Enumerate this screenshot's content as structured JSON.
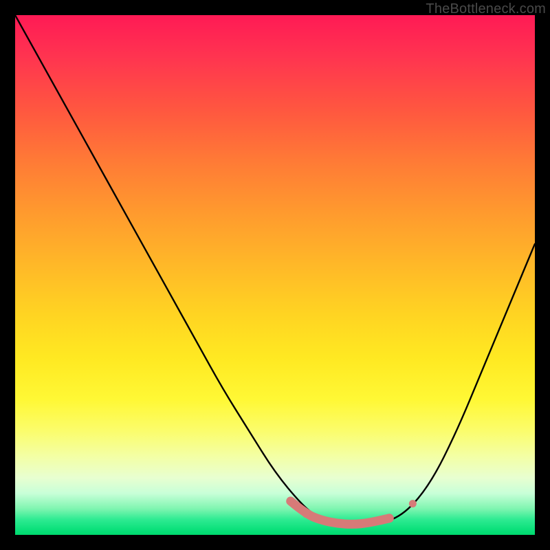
{
  "watermark": "TheBottleneck.com",
  "chart_data": {
    "type": "line",
    "title": "",
    "xlabel": "",
    "ylabel": "",
    "xlim": [
      0,
      100
    ],
    "ylim": [
      0,
      100
    ],
    "grid": false,
    "series": [
      {
        "name": "curve",
        "x": [
          0,
          5,
          10,
          15,
          20,
          25,
          30,
          35,
          40,
          45,
          50,
          55,
          58,
          60,
          63,
          65,
          70,
          75,
          80,
          85,
          90,
          95,
          100
        ],
        "y": [
          100,
          91,
          82,
          73,
          64,
          55,
          46,
          37,
          28,
          20,
          12,
          6,
          3.5,
          2.5,
          2,
          2,
          2,
          4,
          10,
          20,
          32,
          44,
          56
        ]
      }
    ],
    "markers": [
      {
        "name": "left-flat-start",
        "x": 53,
        "y": 6.5
      },
      {
        "name": "flat-1",
        "x": 56,
        "y": 4.0
      },
      {
        "name": "flat-2",
        "x": 59,
        "y": 2.8
      },
      {
        "name": "flat-3",
        "x": 62,
        "y": 2.2
      },
      {
        "name": "flat-4",
        "x": 65,
        "y": 2.0
      },
      {
        "name": "flat-5",
        "x": 68,
        "y": 2.3
      },
      {
        "name": "right-flat-end",
        "x": 72,
        "y": 3.2
      },
      {
        "name": "right-up-dot",
        "x": 76.5,
        "y": 6.0
      }
    ],
    "flat_segment": {
      "x": [
        53,
        56,
        59,
        62,
        65,
        68,
        72
      ],
      "y": [
        6.5,
        4.0,
        2.8,
        2.2,
        2.0,
        2.3,
        3.2
      ]
    },
    "colors": {
      "curve": "#000000",
      "markers": "#d77a78",
      "marker_size_px": 11,
      "flat_stroke_px": 13
    }
  }
}
